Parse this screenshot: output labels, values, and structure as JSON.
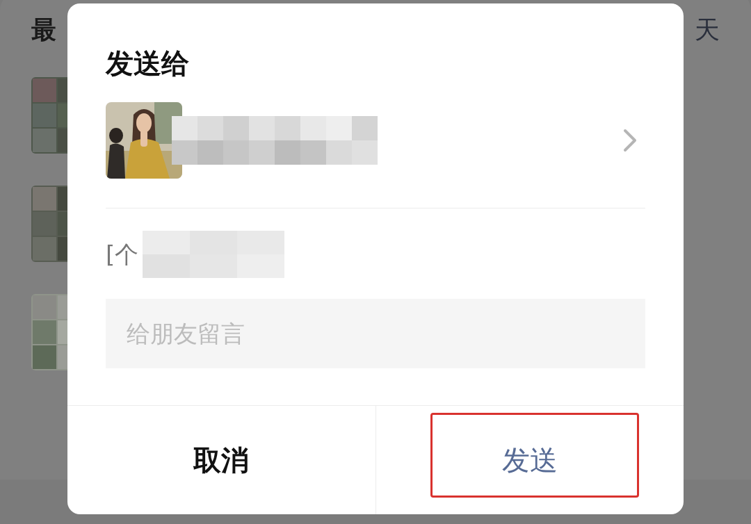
{
  "background": {
    "header_left": "最",
    "header_right": "天"
  },
  "dialog": {
    "title": "发送给",
    "message_preview": "[个",
    "input": {
      "placeholder": "给朋友留言"
    },
    "buttons": [
      {
        "label": "取消",
        "kind": "cancel",
        "highlighted": false
      },
      {
        "label": "发送",
        "kind": "primary",
        "highlighted": true
      }
    ]
  }
}
